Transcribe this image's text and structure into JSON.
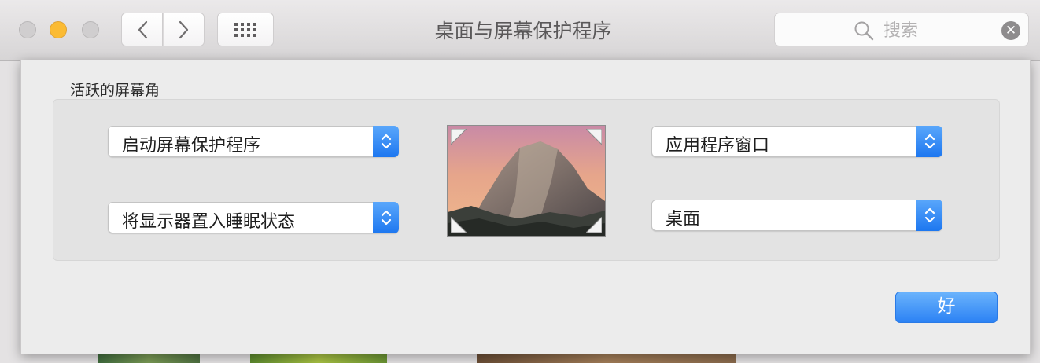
{
  "window": {
    "title": "桌面与屏幕保护程序"
  },
  "toolbar": {
    "back_icon": "chevron-left-icon",
    "forward_icon": "chevron-right-icon",
    "grid_icon": "grid-icon"
  },
  "search": {
    "placeholder": "搜索",
    "value": ""
  },
  "sheet": {
    "section_label": "活跃的屏幕角",
    "corners": {
      "top_left": "启动屏幕保护程序",
      "bottom_left": "将显示器置入睡眠状态",
      "top_right": "应用程序窗口",
      "bottom_right": "桌面"
    },
    "ok_label": "好"
  },
  "colors": {
    "accent": "#2c82f4",
    "minimize": "#fbbb33"
  }
}
